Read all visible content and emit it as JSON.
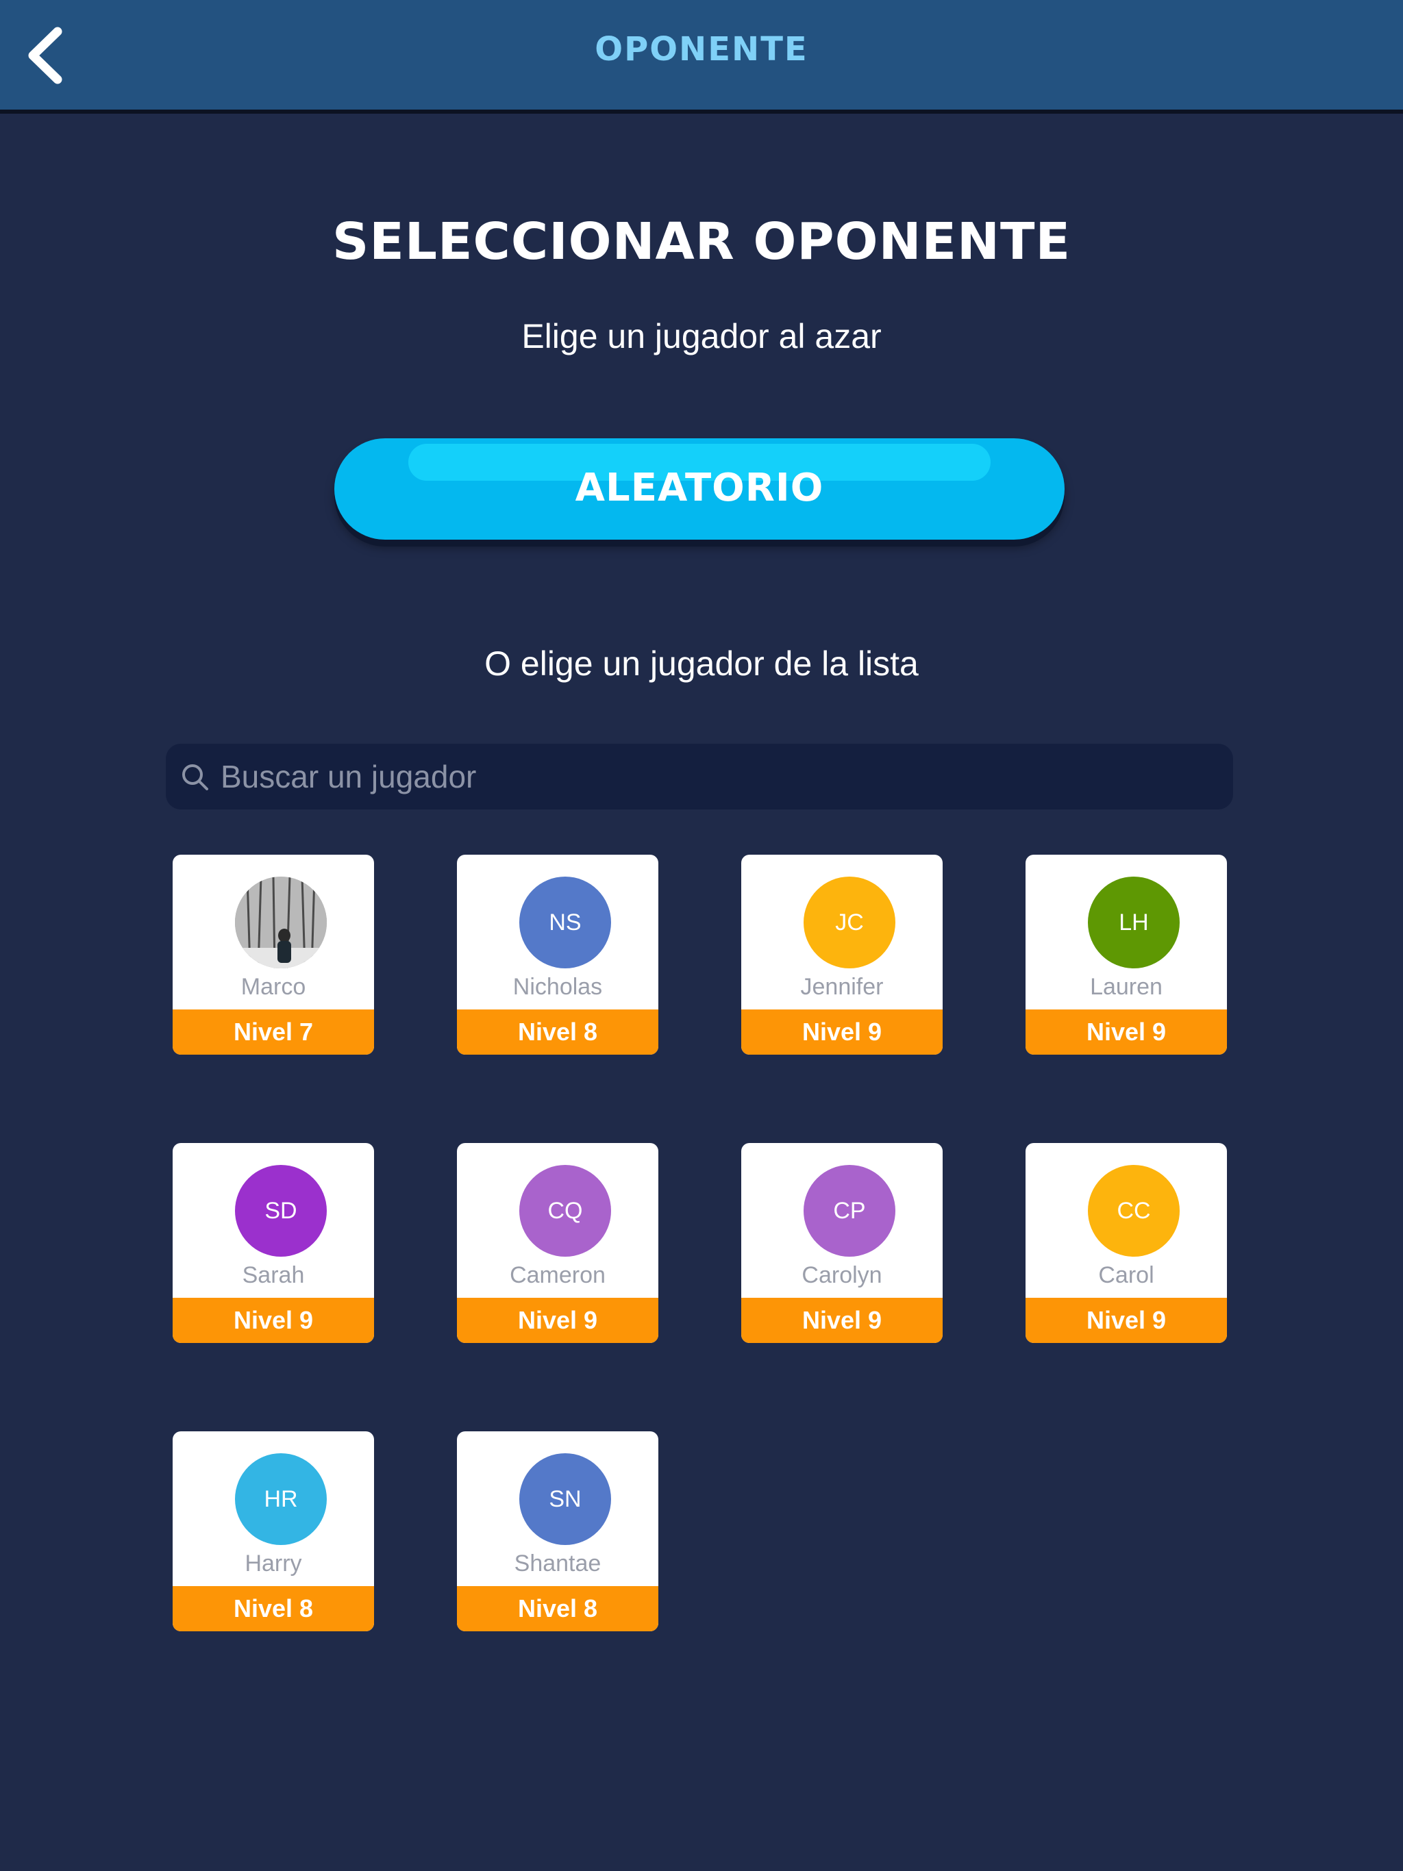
{
  "header": {
    "title": "OPONENTE",
    "back_icon": "chevron-left-icon"
  },
  "main": {
    "title": "SELECCIONAR OPONENTE",
    "subtitle": "Elige un jugador al azar",
    "random_button_label": "ALEATORIO",
    "list_subtitle": "O elige un jugador de la lista"
  },
  "search": {
    "placeholder": "Buscar un jugador",
    "value": "",
    "icon": "search-icon"
  },
  "colors": {
    "background": "#1f2a49",
    "header": "#235280",
    "header_title": "#7fd0f7",
    "random_button": "#04b8ef",
    "level_bar": "#fd9506"
  },
  "players": [
    {
      "initials": "",
      "name": "Marco",
      "level": "Nivel 7",
      "color": "#9a9a9a",
      "photo": true
    },
    {
      "initials": "NS",
      "name": "Nicholas",
      "level": "Nivel 8",
      "color": "#5479c9"
    },
    {
      "initials": "JC",
      "name": "Jennifer",
      "level": "Nivel 9",
      "color": "#fdb40d"
    },
    {
      "initials": "LH",
      "name": "Lauren",
      "level": "Nivel 9",
      "color": "#5e9803"
    },
    {
      "initials": "SD",
      "name": "Sarah",
      "level": "Nivel 9",
      "color": "#9b30cd"
    },
    {
      "initials": "CQ",
      "name": "Cameron",
      "level": "Nivel 9",
      "color": "#a963cc"
    },
    {
      "initials": "CP",
      "name": "Carolyn",
      "level": "Nivel 9",
      "color": "#a963cc"
    },
    {
      "initials": "CC",
      "name": "Carol",
      "level": "Nivel 9",
      "color": "#fdb40d"
    },
    {
      "initials": "HR",
      "name": "Harry",
      "level": "Nivel 8",
      "color": "#33b5e4"
    },
    {
      "initials": "SN",
      "name": "Shantae",
      "level": "Nivel 8",
      "color": "#5479c9"
    }
  ]
}
